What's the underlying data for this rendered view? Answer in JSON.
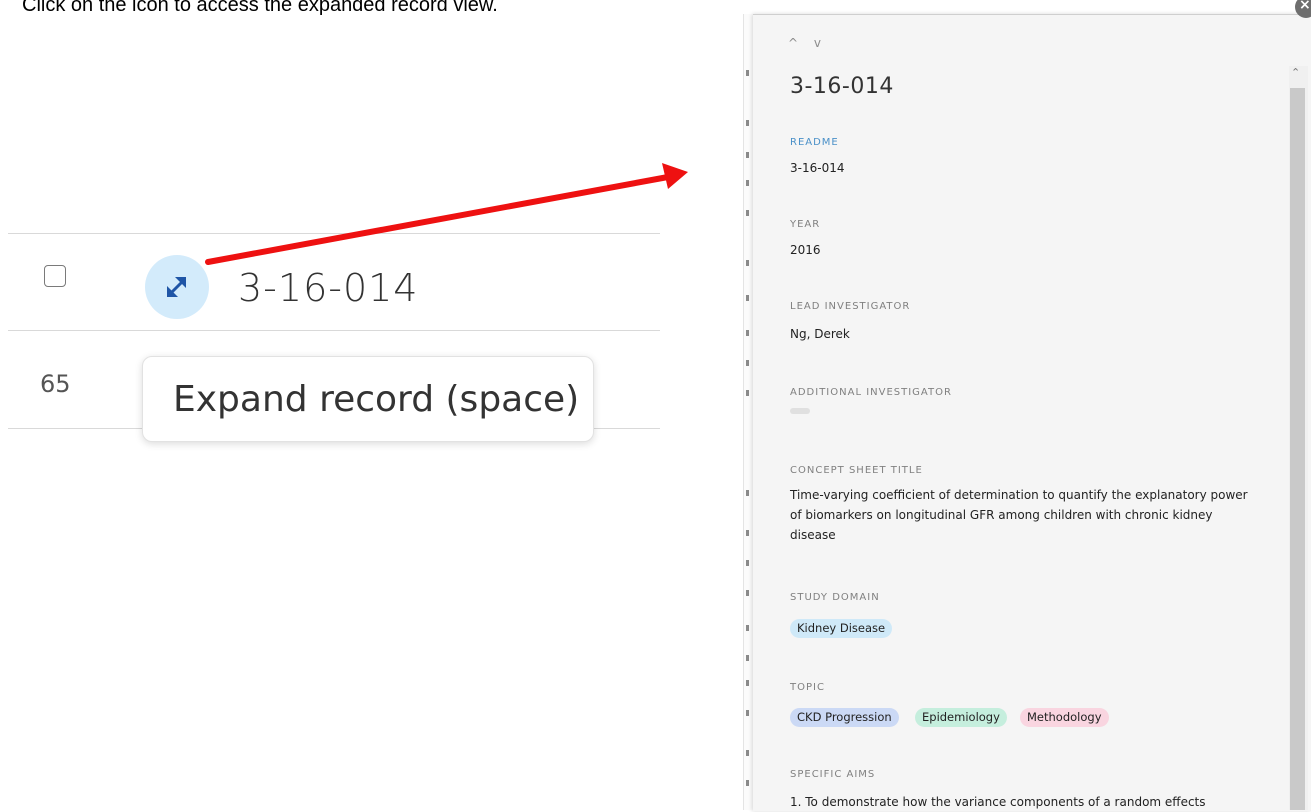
{
  "instruction": "Click on the icon to access the expanded record view.",
  "table": {
    "record_name": "3-16-014",
    "row_number": "65",
    "tooltip": "Expand record (space)"
  },
  "panel": {
    "title": "3-16-014",
    "nav_arrows": "^ v",
    "close_glyph": "×",
    "fields": {
      "readme": {
        "label": "README",
        "value": "3-16-014"
      },
      "year": {
        "label": "YEAR",
        "value": "2016"
      },
      "lead_investigator": {
        "label": "LEAD INVESTIGATOR",
        "value": "Ng, Derek"
      },
      "additional_investigator": {
        "label": "ADDITIONAL INVESTIGATOR"
      },
      "concept_sheet_title": {
        "label": "CONCEPT SHEET TITLE",
        "value": "Time-varying coefficient of determination to quantify the explanatory power of biomarkers on longitudinal GFR among children with chronic kidney disease"
      },
      "study_domain": {
        "label": "STUDY DOMAIN",
        "tags": [
          "Kidney Disease"
        ]
      },
      "topic": {
        "label": "TOPIC",
        "tags": [
          "CKD Progression",
          "Epidemiology",
          "Methodology"
        ]
      },
      "specific_aims": {
        "label": "SPECIFIC AIMS",
        "value": "1. To demonstrate how the variance components of a random effects"
      }
    }
  },
  "colors": {
    "arrow": "#ee1111",
    "expand_button_bg": "#d3ebfb",
    "expand_icon": "#1f55a6",
    "tag_kidney": "#cfe9f8",
    "tag_ckd": "#cbd9f5",
    "tag_epi": "#c5eedd",
    "tag_method": "#f9d5e0"
  }
}
